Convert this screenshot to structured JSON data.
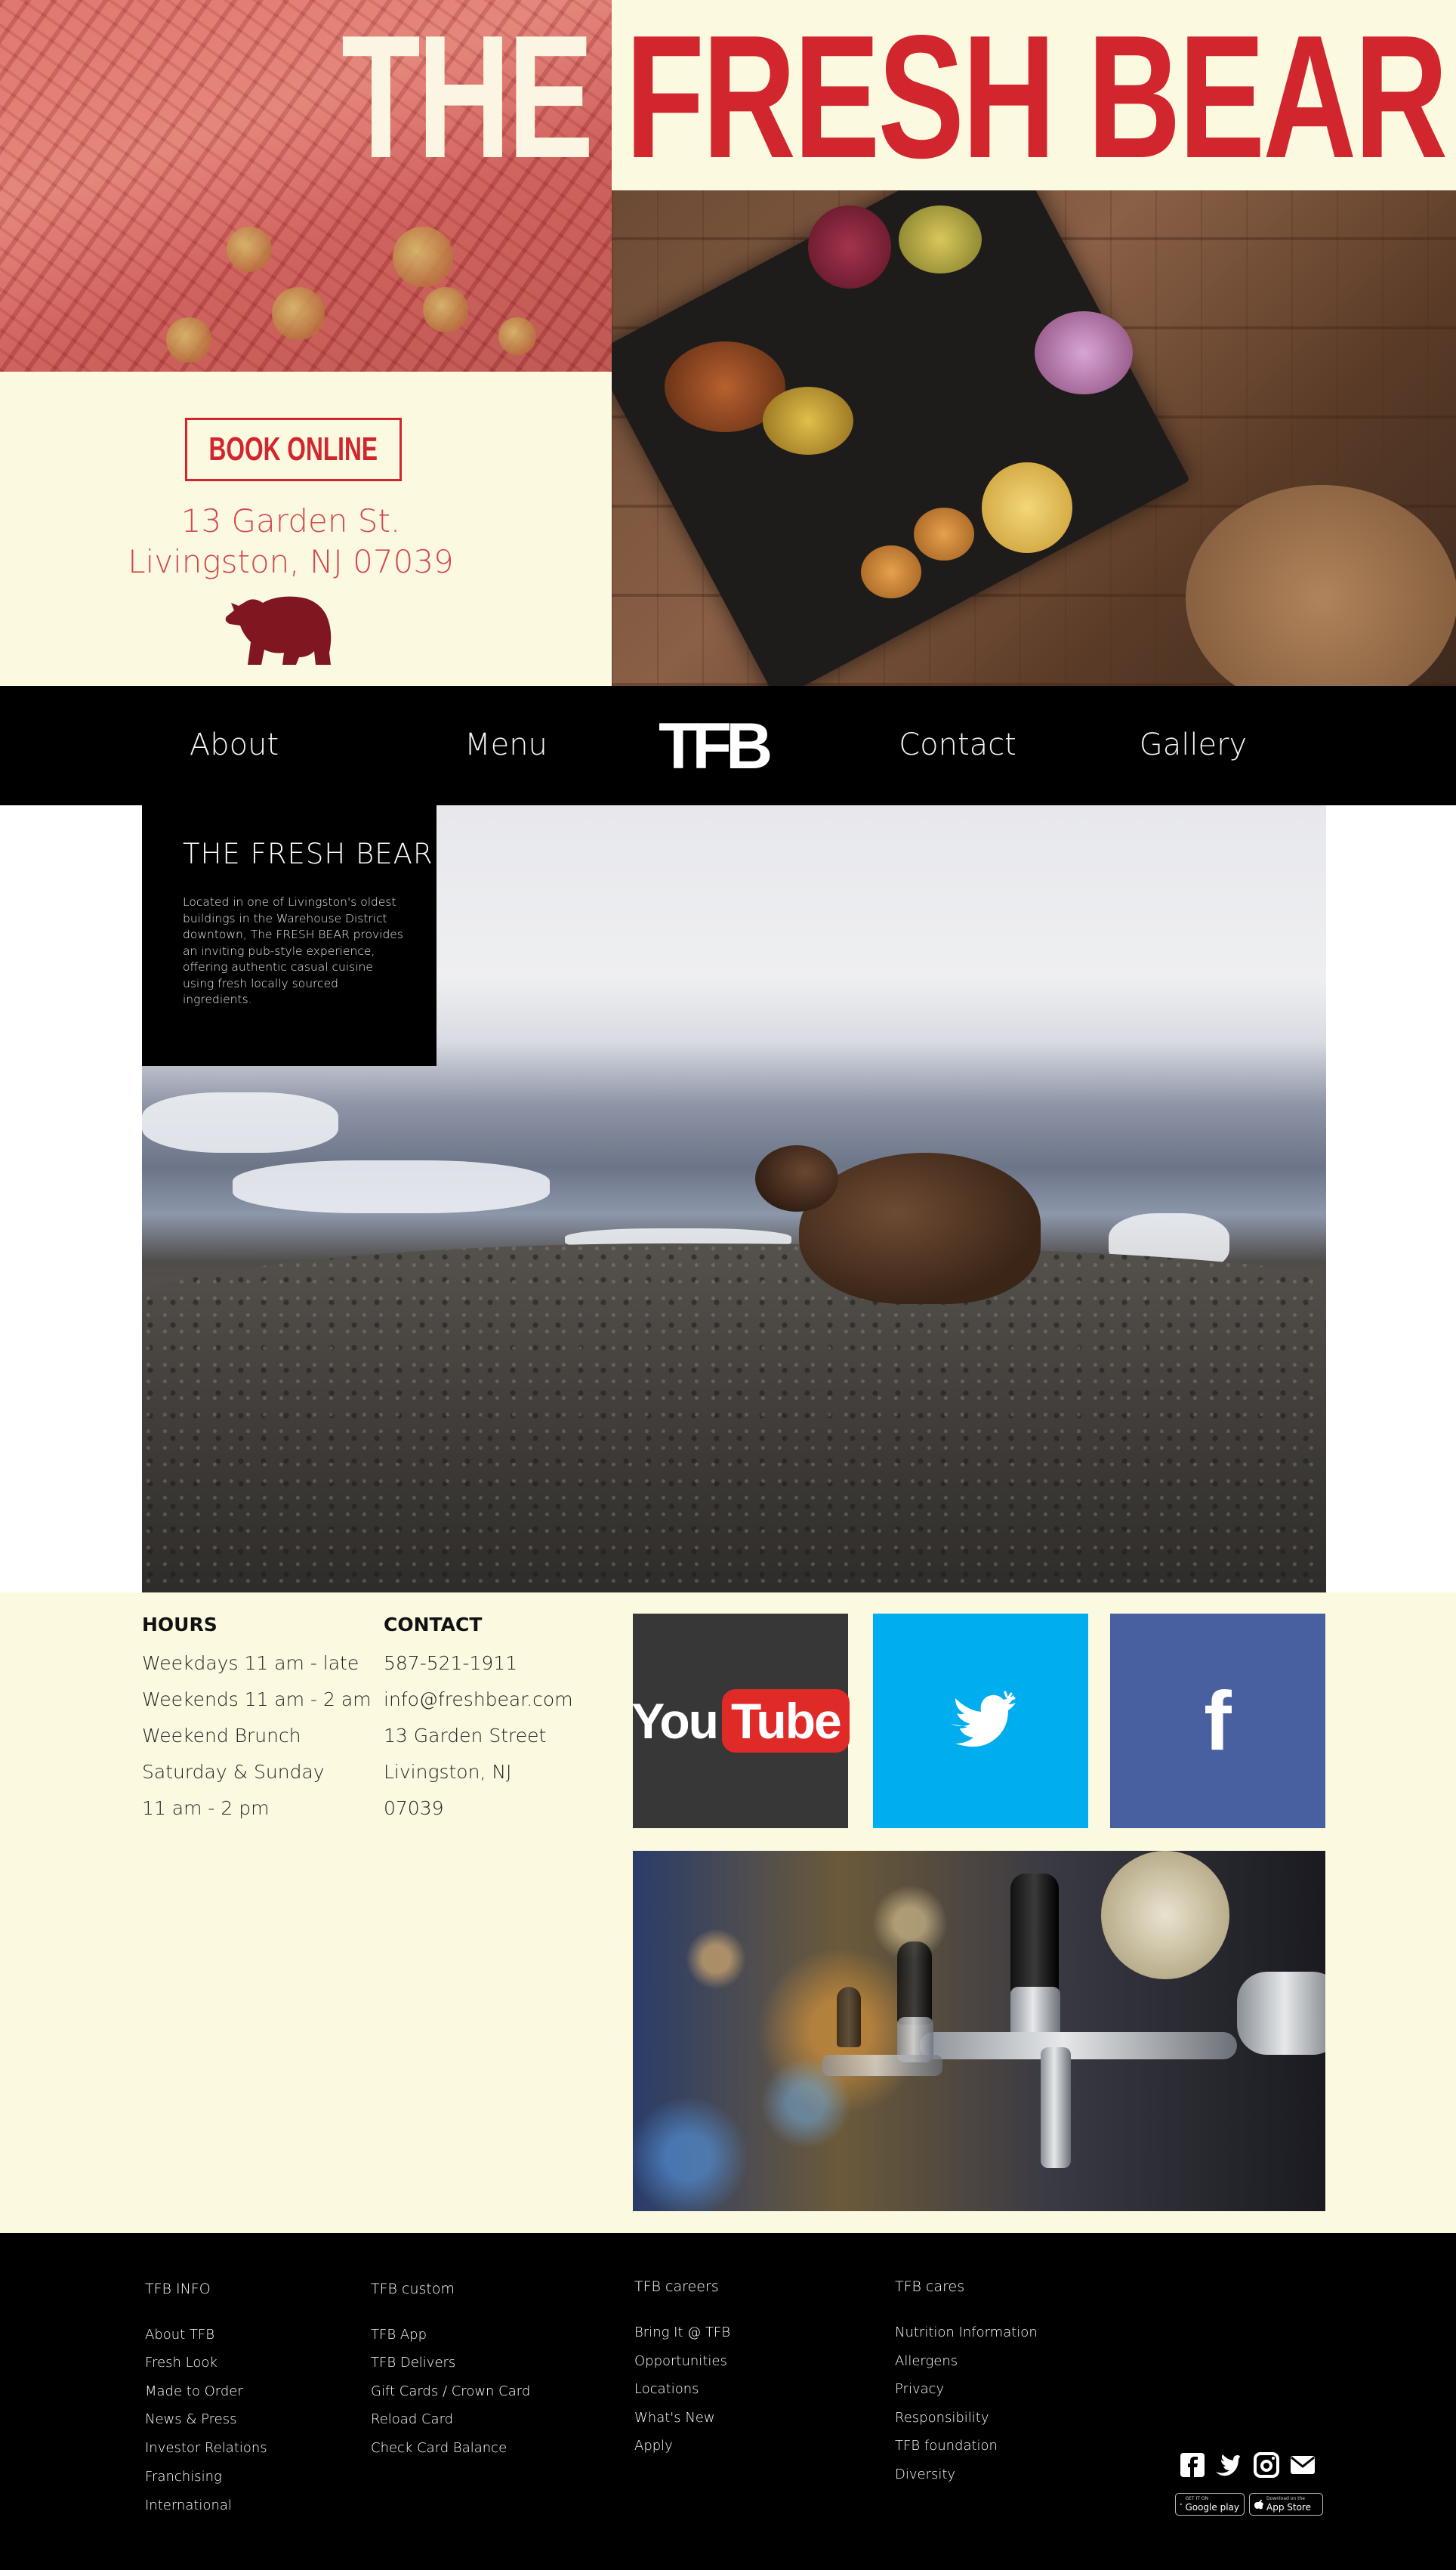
{
  "brand": {
    "title_the": "THE",
    "title_fresh_bear": "FRESH BEAR",
    "logo_short": "TFB",
    "accent_red": "#d2262e",
    "cream": "#fcf9e1"
  },
  "hero": {
    "book_label": "BOOK ONLINE",
    "address_line1": "13 Garden St.",
    "address_line2": "Livingston, NJ 07039",
    "bear_icon": "bear-icon"
  },
  "nav": {
    "about": "About",
    "menu": "Menu",
    "logo": "TFB",
    "contact": "Contact",
    "gallery": "Gallery"
  },
  "about": {
    "title": "THE FRESH BEAR",
    "text": "Located in one of Livingston's oldest buildings in the Warehouse District downtown, The FRESH BEAR provides an inviting pub-style experience, offering authentic casual cuisine using fresh locally sourced ingredients."
  },
  "hours": {
    "heading": "HOURS",
    "lines": [
      "Weekdays 11 am - late",
      "Weekends 11 am - 2 am",
      "Weekend Brunch",
      "Saturday & Sunday",
      "11 am - 2 pm"
    ]
  },
  "contact": {
    "heading": "CONTACT",
    "lines": [
      "587-521-1911",
      "info@freshbear.com",
      "13 Garden Street",
      "Livingston, NJ",
      "07039"
    ]
  },
  "social_tiles": {
    "youtube_you": "You",
    "youtube_tube": "Tube",
    "twitter_icon": "twitter-bird-icon",
    "facebook_f": "f"
  },
  "footer": {
    "columns": [
      {
        "heading": "TFB INFO",
        "links": [
          "About TFB",
          "Fresh Look",
          "Made to Order",
          "News & Press",
          "Investor Relations",
          "Franchising",
          "International"
        ]
      },
      {
        "heading": "TFB custom",
        "links": [
          "TFB App",
          "TFB Delivers",
          "Gift Cards / Crown Card",
          "Reload Card",
          "Check Card Balance"
        ]
      },
      {
        "heading": "TFB careers",
        "links": [
          "Bring It @ TFB",
          "Opportunities",
          "Locations",
          "What's New",
          "Apply"
        ]
      },
      {
        "heading": "TFB cares",
        "links": [
          "Nutrition Information",
          "Allergens",
          "Privacy",
          "Responsibility",
          "TFB foundation",
          "Diversity"
        ]
      }
    ],
    "google_play_small": "GET IT ON",
    "google_play_big": "Google play",
    "app_store_small": "Download on the",
    "app_store_big": "App Store"
  }
}
